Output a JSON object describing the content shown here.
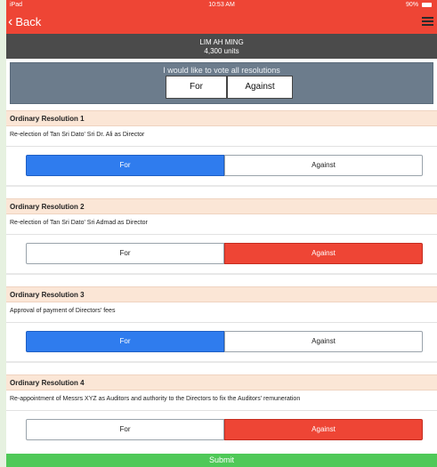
{
  "status_bar": {
    "carrier": "iPad",
    "time": "10:53 AM",
    "battery": "90%"
  },
  "nav": {
    "back_label": "Back"
  },
  "user": {
    "name": "LIM AH MING",
    "units": "4,300 units"
  },
  "vote_all": {
    "prompt": "I would like to vote all resolutions",
    "for_label": "For",
    "against_label": "Against"
  },
  "resolutions": [
    {
      "title": "Ordinary Resolution 1",
      "description": "Re-election of Tan Sri Dato' Sri Dr. Ali as Director",
      "for_label": "For",
      "against_label": "Against",
      "selected": "for"
    },
    {
      "title": "Ordinary Resolution 2",
      "description": "Re-election of Tan Sri Dato' Sri Admad as Director",
      "for_label": "For",
      "against_label": "Against",
      "selected": "against"
    },
    {
      "title": "Ordinary Resolution 3",
      "description": "Approval of payment of Directors' fees",
      "for_label": "For",
      "against_label": "Against",
      "selected": "for"
    },
    {
      "title": "Ordinary Resolution 4",
      "description": "Re-appointment of Messrs XYZ as Auditors and authority to the Directors to fix the Auditors' remuneration",
      "for_label": "For",
      "against_label": "Against",
      "selected": "against"
    }
  ],
  "submit_label": "Submit",
  "colors": {
    "accent_red": "#ee4535",
    "for_blue": "#2f7cee",
    "submit_green": "#4fc958",
    "header_beige": "#fbe6d6"
  }
}
